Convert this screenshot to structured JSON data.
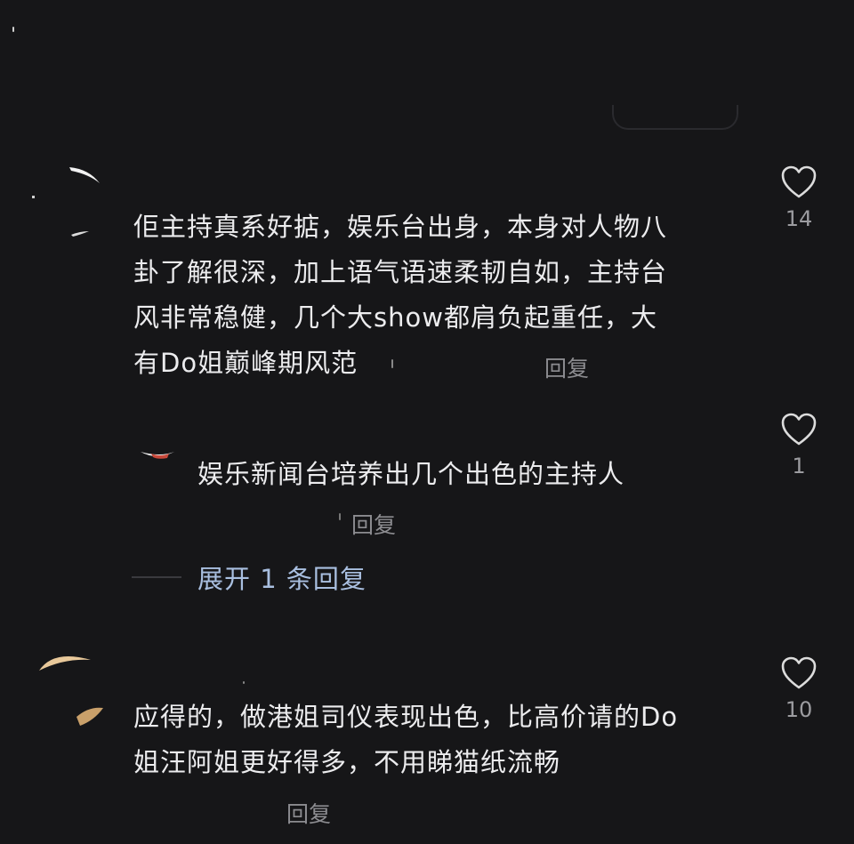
{
  "comments": [
    {
      "lines": [
        "佢主持真系好掂，娱乐台出身，本身对人物八",
        "卦了解很深，加上语气语速柔韧自如，主持台",
        "风非常稳健，几个大show都肩负起重任，大",
        "有Do姐巅峰期风范"
      ],
      "reply_label": "回复",
      "likes": "14"
    },
    {
      "lines": [
        "娱乐新闻台培养出几个出色的主持人"
      ],
      "reply_label": "回复",
      "likes": "1",
      "is_sub_reply": true
    },
    {
      "lines": [
        "应得的，做港姐司仪表现出色，比高价请的Do",
        "姐汪阿姐更好得多，不用睇猫纸流畅"
      ],
      "reply_label": "回复",
      "likes": "10"
    }
  ],
  "expand_replies": {
    "label": "展开 1 条回复"
  },
  "icons": {
    "like": "heart-outline-icon"
  },
  "colors": {
    "background": "#161618",
    "text": "#ececee",
    "muted": "#8c8c90",
    "link": "#a9bfe0"
  }
}
